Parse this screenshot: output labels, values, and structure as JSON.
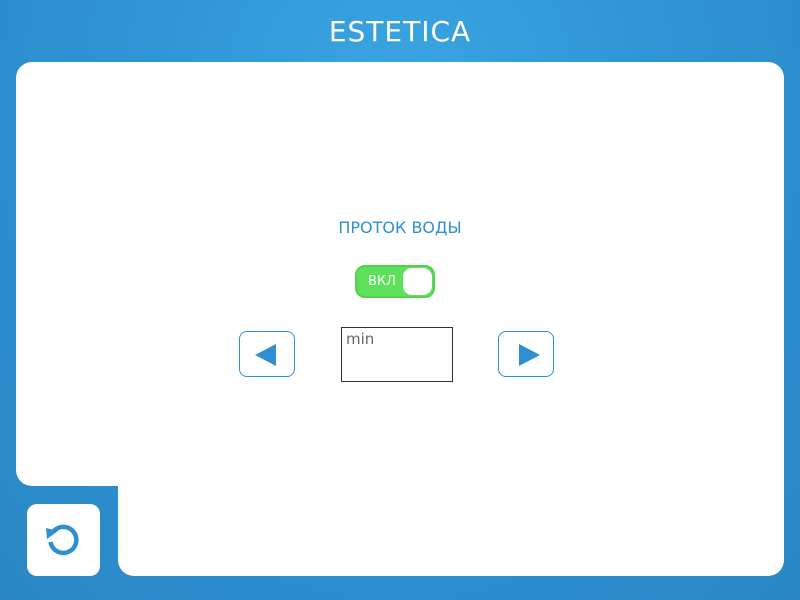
{
  "header": {
    "title": "ESTETICA"
  },
  "main": {
    "section_title": "ПРОТОК ВОДЫ",
    "toggle": {
      "label": "ВКЛ",
      "state": "on",
      "color": "#5fe05a"
    },
    "value_field": {
      "unit": "min",
      "value": ""
    },
    "decrease_button": {
      "icon": "triangle-left-icon"
    },
    "increase_button": {
      "icon": "triangle-right-icon"
    }
  },
  "footer": {
    "reset_button": {
      "icon": "refresh-icon"
    }
  },
  "colors": {
    "accent": "#2f8fd0",
    "background": "#2f96d6",
    "toggle_on": "#5fe05a"
  }
}
